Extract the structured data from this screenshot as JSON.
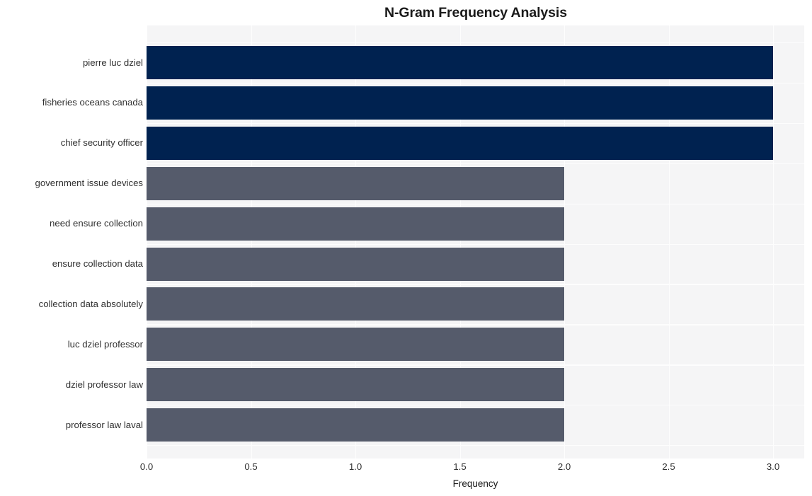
{
  "chart_data": {
    "type": "bar",
    "orientation": "horizontal",
    "title": "N-Gram Frequency Analysis",
    "xlabel": "Frequency",
    "ylabel": "",
    "xlim": [
      0.0,
      3.0
    ],
    "xticks": [
      "0.0",
      "0.5",
      "1.0",
      "1.5",
      "2.0",
      "2.5",
      "3.0"
    ],
    "xtick_values": [
      0.0,
      0.5,
      1.0,
      1.5,
      2.0,
      2.5,
      3.0
    ],
    "grid": true,
    "grid_color": "#fdfdfd",
    "plot_background": "#f5f5f6",
    "figure_background": "#ffffff",
    "legend": null,
    "categories": [
      "pierre luc dziel",
      "fisheries oceans canada",
      "chief security officer",
      "government issue devices",
      "need ensure collection",
      "ensure collection data",
      "collection data absolutely",
      "luc dziel professor",
      "dziel professor law",
      "professor law laval"
    ],
    "values": [
      3,
      3,
      3,
      2,
      2,
      2,
      2,
      2,
      2,
      2
    ],
    "bar_colors": [
      "#002250",
      "#002250",
      "#002250",
      "#555b6b",
      "#555b6b",
      "#555b6b",
      "#555b6b",
      "#555b6b",
      "#555b6b",
      "#555b6b"
    ],
    "colors": {
      "high": "#002250",
      "low": "#555b6b",
      "text": "#303030",
      "title": "#1a1a1a"
    }
  }
}
